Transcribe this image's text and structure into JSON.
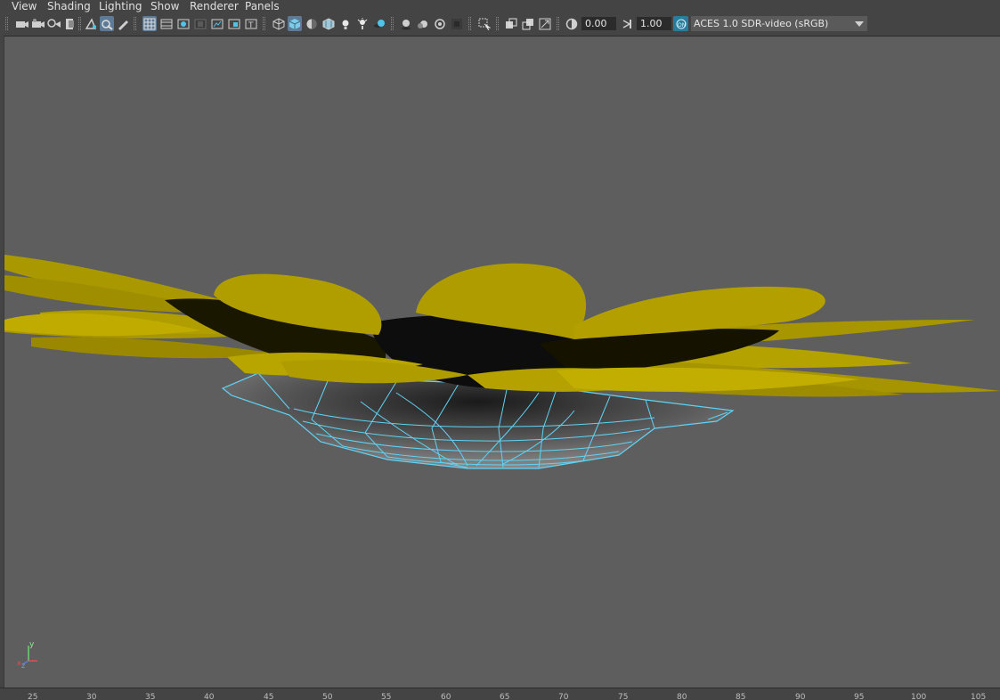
{
  "menu": {
    "items": [
      "View",
      "Shading",
      "Lighting",
      "Show",
      "Renderer",
      "Panels"
    ]
  },
  "toolbar": {
    "icons": [
      "select-camera-icon",
      "camera-attributes-icon",
      "bookmarks-icon",
      "image-plane-icon",
      "2d-pan-zoom-icon",
      "grease-pencil-icon",
      "grid-icon",
      "film-gate-icon",
      "resolution-gate-icon",
      "gate-mask-icon",
      "field-chart-icon",
      "safe-action-icon",
      "safe-title-icon",
      "wireframe-icon",
      "smooth-shade-icon",
      "default-material-icon",
      "textured-icon",
      "use-all-lights-icon",
      "shadows-icon",
      "screen-space-ao-icon",
      "motion-blur-icon",
      "multisample-aa-icon",
      "depth-of-field-icon",
      "isolate-select-icon",
      "xray-icon",
      "xray-joints-icon",
      "xray-components-icon",
      "backface-culling-icon",
      "exposure-icon",
      "gamma-icon",
      "color-management-icon"
    ],
    "exposure_value": "0.00",
    "gamma_value": "1.00",
    "color_space": "ACES 1.0 SDR-video (sRGB)"
  },
  "colors": {
    "petal": "#b3a000",
    "petal_dark": "#6e6200",
    "wireframe": "#5fd3f5",
    "viewport_bg": "#5e5e5e",
    "ui_bg": "#444444"
  },
  "axis": {
    "y_label": "y",
    "x_label": "x",
    "z_label": "z"
  },
  "ruler": {
    "labels": [
      "25",
      "30",
      "35",
      "40",
      "45",
      "50",
      "55",
      "60",
      "65",
      "70",
      "75",
      "80",
      "85",
      "90",
      "95",
      "100",
      "105"
    ]
  }
}
